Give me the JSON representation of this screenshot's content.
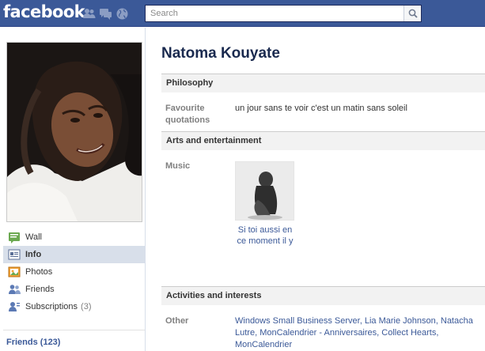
{
  "topbar": {
    "logo": "facebook",
    "search_placeholder": "Search",
    "jewels": [
      "friend-requests-icon",
      "messages-icon",
      "notifications-globe-icon"
    ]
  },
  "profile": {
    "name": "Natoma Kouyate"
  },
  "nav": {
    "items": [
      {
        "label": "Wall",
        "icon": "wall-icon",
        "active": false,
        "count": ""
      },
      {
        "label": "Info",
        "icon": "info-icon",
        "active": true,
        "count": ""
      },
      {
        "label": "Photos",
        "icon": "photos-icon",
        "active": false,
        "count": ""
      },
      {
        "label": "Friends",
        "icon": "friends-icon",
        "active": false,
        "count": ""
      },
      {
        "label": "Subscriptions",
        "icon": "subscriptions-icon",
        "active": false,
        "count": "(3)"
      }
    ],
    "friends_link": "Friends (123)"
  },
  "sections": {
    "philosophy": {
      "title": "Philosophy",
      "fav_label_1": "Favourite",
      "fav_label_2": "quotations",
      "fav_value": "un jour sans te voir c'est un matin sans soleil"
    },
    "arts": {
      "title": "Arts and entertainment",
      "music_label": "Music",
      "music_caption_1": "Si toi aussi en",
      "music_caption_2": "ce moment il y"
    },
    "activities": {
      "title": "Activities and interests",
      "other_label": "Other",
      "other_links": [
        {
          "text": "Windows Small Business Server",
          "sep": ", "
        },
        {
          "text": "Lia Marie Johnson",
          "sep": ", "
        },
        {
          "text": "Natacha Lutre",
          "sep": ", "
        },
        {
          "text": "MonCalendrier - Anniversaires",
          "sep": ", "
        },
        {
          "text": "Collect Hearts",
          "sep": ", "
        },
        {
          "text": "MonCalendrier",
          "sep": ""
        }
      ]
    }
  },
  "colors": {
    "brand_blue": "#3b5998",
    "section_bg": "#f2f2f2",
    "nav_active_bg": "#d8dfea"
  }
}
